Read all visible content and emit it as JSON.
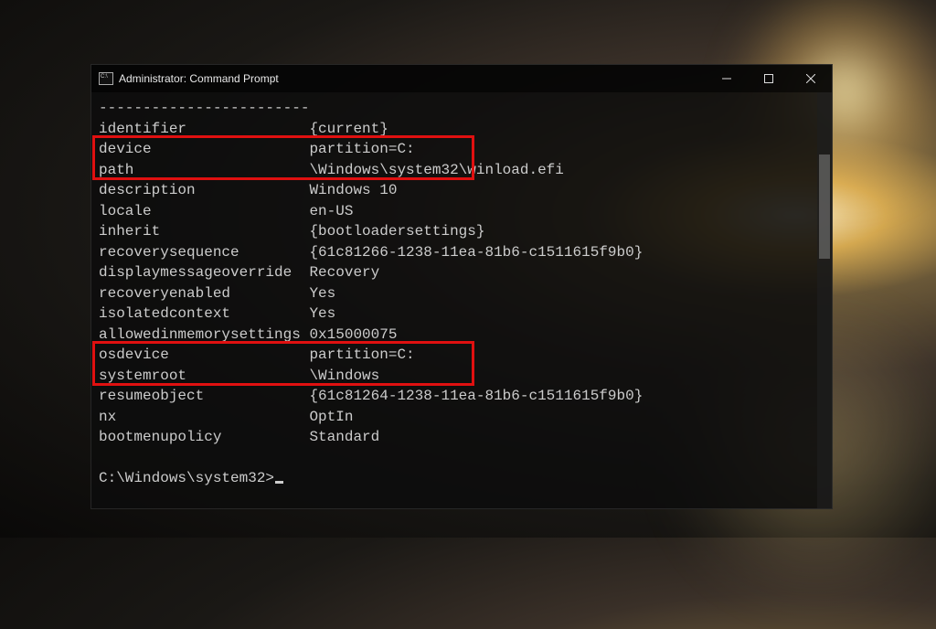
{
  "window": {
    "title": "Administrator: Command Prompt"
  },
  "terminal": {
    "dashes": "------------------------",
    "rows": [
      {
        "k": "identifier",
        "v": "{current}"
      },
      {
        "k": "device",
        "v": "partition=C:"
      },
      {
        "k": "path",
        "v": "\\Windows\\system32\\winload.efi"
      },
      {
        "k": "description",
        "v": "Windows 10"
      },
      {
        "k": "locale",
        "v": "en-US"
      },
      {
        "k": "inherit",
        "v": "{bootloadersettings}"
      },
      {
        "k": "recoverysequence",
        "v": "{61c81266-1238-11ea-81b6-c1511615f9b0}"
      },
      {
        "k": "displaymessageoverride",
        "v": "Recovery"
      },
      {
        "k": "recoveryenabled",
        "v": "Yes"
      },
      {
        "k": "isolatedcontext",
        "v": "Yes"
      },
      {
        "k": "allowedinmemorysettings",
        "v": "0x15000075"
      },
      {
        "k": "osdevice",
        "v": "partition=C:"
      },
      {
        "k": "systemroot",
        "v": "\\Windows"
      },
      {
        "k": "resumeobject",
        "v": "{61c81264-1238-11ea-81b6-c1511615f9b0}"
      },
      {
        "k": "nx",
        "v": "OptIn"
      },
      {
        "k": "bootmenupolicy",
        "v": "Standard"
      }
    ],
    "blank": "",
    "prompt": "C:\\Windows\\system32>"
  },
  "highlights": [
    {
      "row_index": 1,
      "label": "device partition=C:"
    },
    {
      "row_index": 11,
      "label": "osdevice partition=C:"
    }
  ]
}
